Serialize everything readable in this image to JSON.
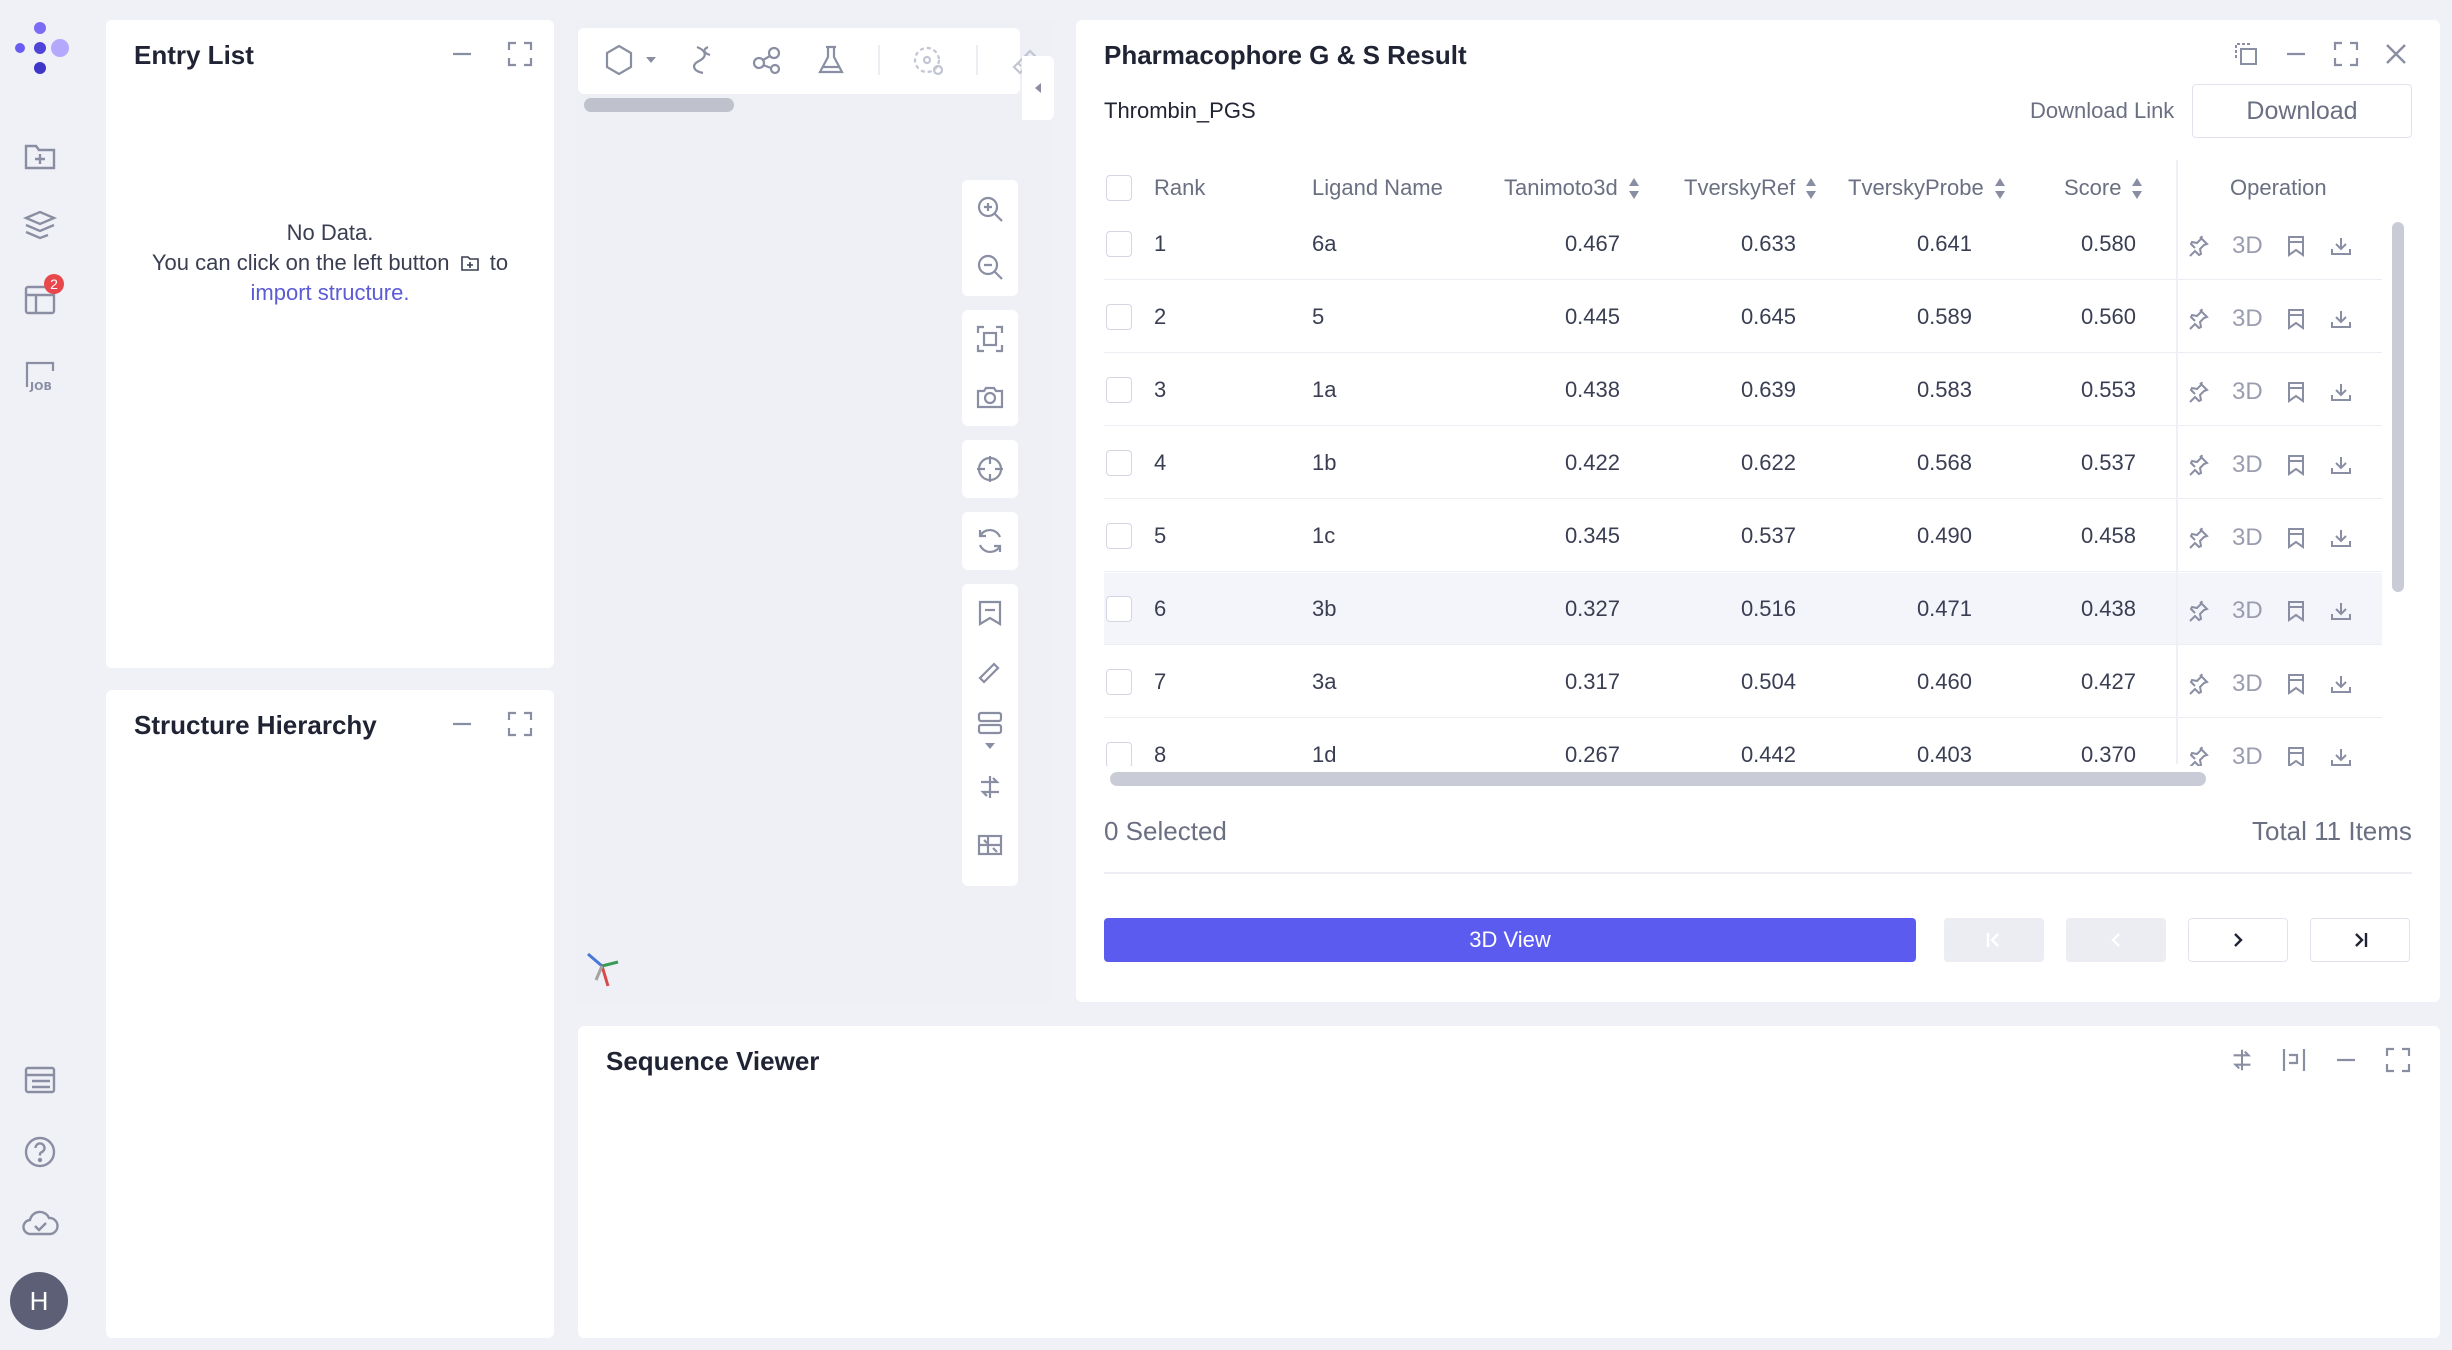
{
  "nav": {
    "badge_count": "2",
    "avatar_letter": "H"
  },
  "entry_list": {
    "title": "Entry List",
    "no_data": "No Data.",
    "hint_before": "You can click on the left button",
    "hint_after": "to",
    "import_link": "import structure."
  },
  "structure_hierarchy": {
    "title": "Structure Hierarchy"
  },
  "result": {
    "title": "Pharmacophore G & S Result",
    "job_name": "Thrombin_PGS",
    "download_link": "Download Link",
    "download_button": "Download",
    "columns": {
      "rank": "Rank",
      "ligand": "Ligand Name",
      "tanimoto": "Tanimoto3d",
      "tversky_ref": "TverskyRef",
      "tversky_probe": "TverskyProbe",
      "score": "Score",
      "operation": "Operation"
    },
    "op_3d_label": "3D",
    "rows": [
      {
        "rank": "1",
        "ligand": "6a",
        "tanimoto": "0.467",
        "tversky_ref": "0.633",
        "tversky_probe": "0.641",
        "score": "0.580"
      },
      {
        "rank": "2",
        "ligand": "5",
        "tanimoto": "0.445",
        "tversky_ref": "0.645",
        "tversky_probe": "0.589",
        "score": "0.560"
      },
      {
        "rank": "3",
        "ligand": "1a",
        "tanimoto": "0.438",
        "tversky_ref": "0.639",
        "tversky_probe": "0.583",
        "score": "0.553"
      },
      {
        "rank": "4",
        "ligand": "1b",
        "tanimoto": "0.422",
        "tversky_ref": "0.622",
        "tversky_probe": "0.568",
        "score": "0.537"
      },
      {
        "rank": "5",
        "ligand": "1c",
        "tanimoto": "0.345",
        "tversky_ref": "0.537",
        "tversky_probe": "0.490",
        "score": "0.458"
      },
      {
        "rank": "6",
        "ligand": "3b",
        "tanimoto": "0.327",
        "tversky_ref": "0.516",
        "tversky_probe": "0.471",
        "score": "0.438"
      },
      {
        "rank": "7",
        "ligand": "3a",
        "tanimoto": "0.317",
        "tversky_ref": "0.504",
        "tversky_probe": "0.460",
        "score": "0.427"
      },
      {
        "rank": "8",
        "ligand": "1d",
        "tanimoto": "0.267",
        "tversky_ref": "0.442",
        "tversky_probe": "0.403",
        "score": "0.370"
      }
    ],
    "selected_text": "0 Selected",
    "total_text": "Total 11 Items",
    "view_button": "3D View"
  },
  "sequence_viewer": {
    "title": "Sequence Viewer"
  },
  "colors": {
    "accent": "#5b5bf0",
    "brand_dot": "#6a5cf0",
    "badge": "#e8484c"
  }
}
